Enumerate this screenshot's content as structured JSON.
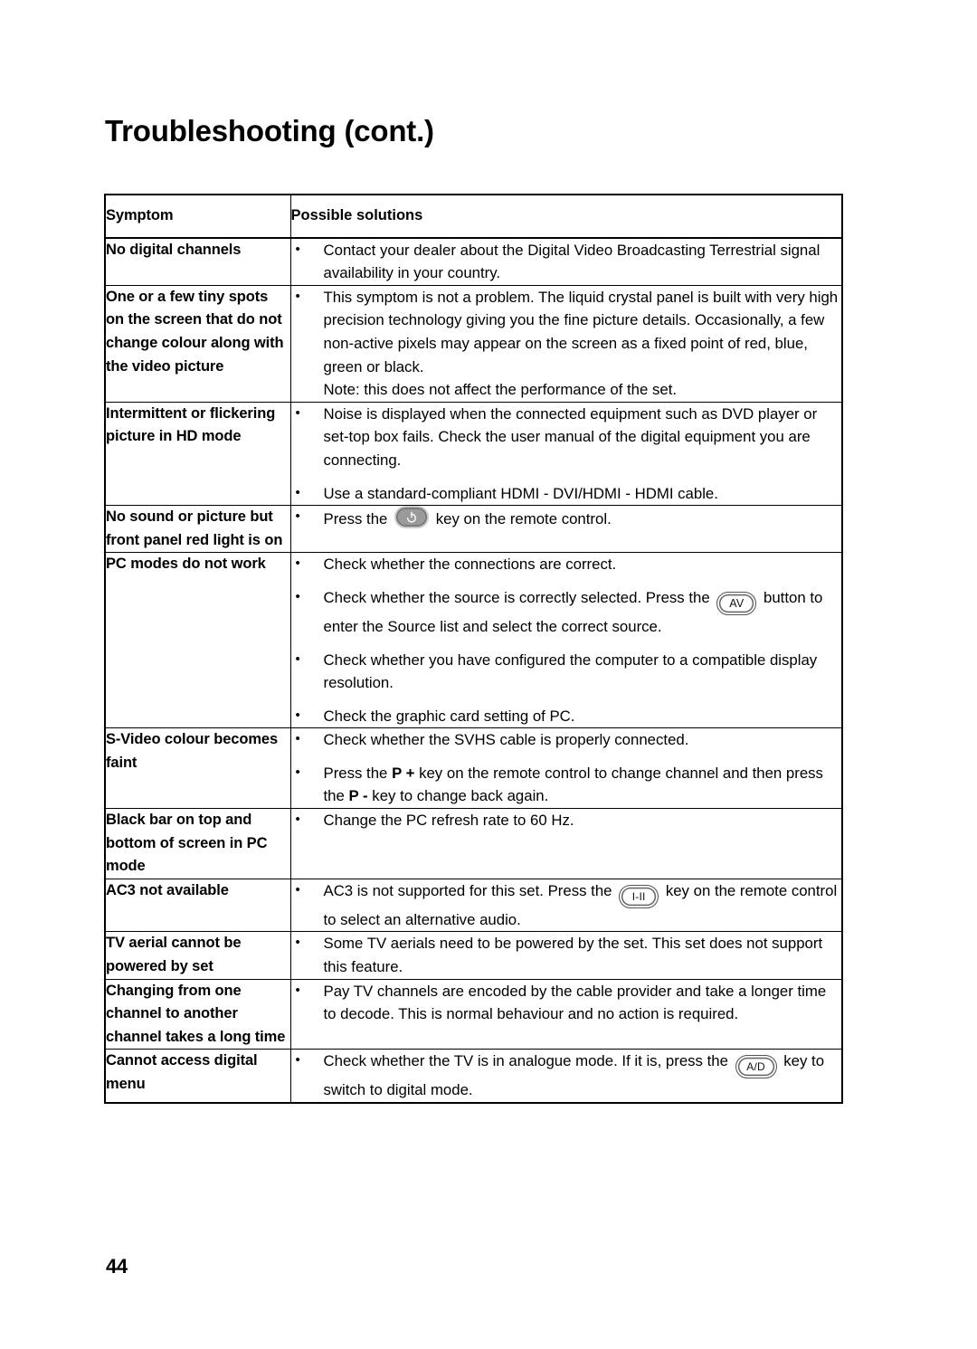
{
  "page": {
    "title": "Troubleshooting (cont.)",
    "number": "44"
  },
  "table": {
    "headers": {
      "symptom": "Symptom",
      "solutions": "Possible solutions"
    },
    "rows": [
      {
        "symptom": "No digital channels",
        "bullets": [
          {
            "text": "Contact your dealer about the Digital Video Broadcasting Terrestrial signal availability in your country."
          }
        ]
      },
      {
        "symptom": "One or a few tiny spots on the screen that do not change colour along with the video picture",
        "bullets": [
          {
            "text": "This symptom is not a problem. The liquid crystal panel is built with very high precision technology giving you the fine picture details. Occasionally, a few non-active pixels may appear on the screen as a fixed point of red, blue, green or black."
          }
        ],
        "note": "Note: this does not affect the performance of the set."
      },
      {
        "symptom": "Intermittent or flickering picture in HD mode",
        "bullets": [
          {
            "text": "Noise is displayed when the connected equipment such as DVD player or set-top box fails. Check the user manual of the digital equipment you are connecting."
          },
          {
            "text": "Use a standard-compliant HDMI - DVI/HDMI - HDMI cable."
          }
        ]
      },
      {
        "symptom": "No sound or picture but front panel red light is on",
        "bullets": [
          {
            "before": "Press the ",
            "key": "power-key",
            "after": " key on the remote control."
          }
        ]
      },
      {
        "symptom": "PC modes do not work",
        "bullets": [
          {
            "text": "Check whether the connections are correct."
          },
          {
            "before": "Check whether the source is correctly selected. Press the ",
            "key": "AV",
            "after": " button to enter the Source list and select the correct source."
          },
          {
            "text": "Check whether you have configured the computer to a compatible display resolution."
          },
          {
            "text": "Check the graphic card setting of PC."
          }
        ]
      },
      {
        "symptom": "S-Video colour becomes faint",
        "bullets": [
          {
            "text": "Check whether the SVHS cable is properly connected."
          },
          {
            "before": "Press the ",
            "kbd1": "P +",
            "middle": " key on the remote control to change channel and then press the ",
            "kbd2": "P -",
            "after": " key to change back again."
          }
        ]
      },
      {
        "symptom": "Black bar on top and bottom of screen in PC mode",
        "bullets": [
          {
            "text": "Change the PC refresh rate to 60 Hz."
          }
        ]
      },
      {
        "symptom": "AC3 not available",
        "bullets": [
          {
            "before": "AC3 is not supported for this set. Press the ",
            "key": "I-II",
            "after": " key on the remote control to select an alternative audio."
          }
        ]
      },
      {
        "symptom": "TV aerial cannot be powered by set",
        "bullets": [
          {
            "text": "Some TV aerials need to be powered by the set. This set does not support this feature."
          }
        ]
      },
      {
        "symptom": "Changing from one channel to another channel takes a long time",
        "bullets": [
          {
            "text": "Pay TV channels are encoded by the cable provider and take a longer time to decode. This is normal behaviour and no action is required."
          }
        ]
      },
      {
        "symptom": "Cannot access digital menu",
        "bullets": [
          {
            "before": "Check whether the TV is in analogue mode. If it is, press the ",
            "key": "A/D",
            "after": " key to switch to digital mode."
          }
        ]
      }
    ]
  },
  "colors": {
    "text": "#000000",
    "border": "#000000",
    "key_fill": "#9a9a9a",
    "key_outline": "#555555",
    "background": "#ffffff"
  }
}
